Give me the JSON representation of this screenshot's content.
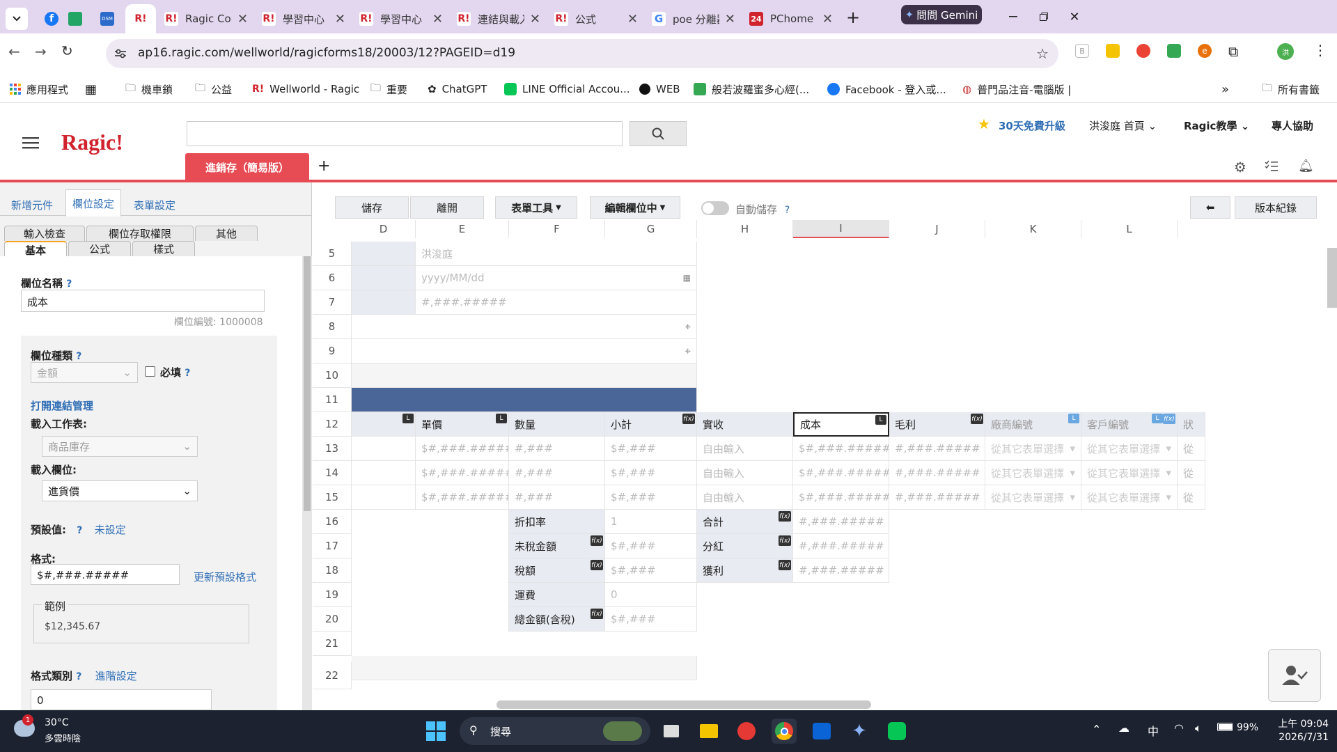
{
  "browser": {
    "tabs": [
      {
        "label": "Ragic Comr"
      },
      {
        "label": "學習中心"
      },
      {
        "label": "學習中心"
      },
      {
        "label": "連結與載入"
      },
      {
        "label": "公式"
      },
      {
        "label": "poe 分離器"
      },
      {
        "label": "PChome 24"
      }
    ],
    "gemini_label": "問問 Gemini",
    "url": "ap16.ragic.com/wellworld/ragicforms18/20003/12?PAGEID=d19",
    "bookmarks": [
      "應用程式",
      "機車鎖",
      "公益",
      "Wellworld - Ragic",
      "重要",
      "ChatGPT",
      "LINE Official Accou...",
      "WEB",
      "般若波羅蜜多心經(...",
      "Facebook - 登入或...",
      "普門品注音-電腦版 |"
    ],
    "all_bookmarks": "所有書籤",
    "profile_initial": "洪"
  },
  "ragic": {
    "logo": "Ragic!",
    "upgrade": "30天免費升級",
    "home": "洪浚庭 首頁",
    "tutorial": "Ragic教學",
    "help": "專人協助",
    "sheet_tab": "進銷存（簡易版）",
    "add_tab": "+"
  },
  "left_panel": {
    "top_tabs": [
      "新增元件",
      "欄位設定",
      "表單設定"
    ],
    "sub_tabs_row1": [
      "輸入檢查",
      "欄位存取權限",
      "其他"
    ],
    "sub_tabs_row2": [
      "基本",
      "公式",
      "樣式"
    ],
    "field_name_label": "欄位名稱",
    "field_name_value": "成本",
    "field_id": "欄位編號: 1000008",
    "field_type_label": "欄位種類",
    "field_type_value": "金額",
    "required_label": "必填",
    "open_link": "打開連結管理",
    "load_sheet_label": "載入工作表:",
    "load_sheet_value": "商品庫存",
    "load_field_label": "載入欄位:",
    "load_field_value": "進貨價",
    "default_label": "預設值:",
    "default_value": "未設定",
    "format_label": "格式:",
    "format_value": "$#,###.#####",
    "update_format": "更新預設格式",
    "example_label": "範例",
    "example_value": "$12,345.67",
    "format_type_label": "格式類別",
    "advanced": "進階設定",
    "format_type_value": "0",
    "help_mark": "?"
  },
  "toolbar": {
    "save": "儲存",
    "leave": "離開",
    "form_tools": "表單工具",
    "editing": "編輯欄位中",
    "autosave": "自動儲存",
    "back": "⬅",
    "version": "版本紀錄"
  },
  "grid": {
    "columns": [
      "D",
      "E",
      "F",
      "G",
      "H",
      "I",
      "J",
      "K",
      "L"
    ],
    "rows": [
      "5",
      "6",
      "7",
      "8",
      "9",
      "10",
      "11",
      "12",
      "13",
      "14",
      "15",
      "16",
      "17",
      "18",
      "19",
      "20",
      "21",
      "22"
    ],
    "r5_name": "洪浚庭",
    "r6_date": "yyyy/MM/dd",
    "r7_num": "#,###.#####",
    "header12": [
      "單價",
      "數量",
      "小計",
      "實收",
      "成本",
      "毛利",
      "廠商編號",
      "客戶編號",
      "狀"
    ],
    "data_row": [
      "$#,###.#####",
      "#,###",
      "$#,###",
      "自由輸入",
      "$#,###.#####",
      "#,###.#####",
      "從其它表單選擇",
      "從其它表單選擇",
      "從"
    ],
    "summary_left": [
      {
        "label": "折扣率",
        "value": "1"
      },
      {
        "label": "未稅金額",
        "value": "$#,###"
      },
      {
        "label": "稅額",
        "value": "$#,###"
      },
      {
        "label": "運費",
        "value": "0"
      },
      {
        "label": "總金額(含稅)",
        "value": "$#,###"
      }
    ],
    "summary_right": [
      {
        "label": "合計",
        "value": "#,###.#####"
      },
      {
        "label": "分紅",
        "value": "#,###.#####"
      },
      {
        "label": "獲利",
        "value": "#,###.#####"
      }
    ]
  },
  "taskbar": {
    "weather_temp": "30°C",
    "weather_desc": "多雲時陰",
    "weather_badge": "1",
    "search": "搜尋",
    "ime": "中",
    "battery": "99%",
    "time": "上午 09:04",
    "date": "2026/7/31"
  },
  "colors": {
    "accent": "#e74c55",
    "brand": "#d0232e",
    "link": "#2f6eb5",
    "banner": "#4a6698",
    "tab_bg": "#e3d7f0"
  }
}
